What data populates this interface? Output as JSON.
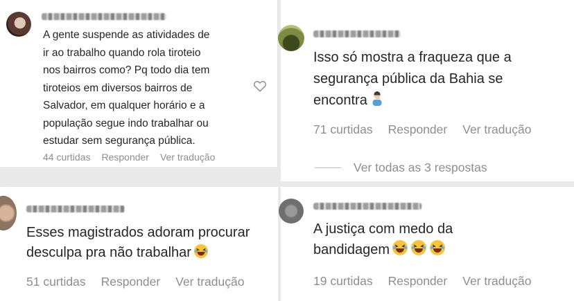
{
  "comments": [
    {
      "text": "A gente suspende as atividades de\nir ao trabalho quando rola tiroteio\nnos bairros como? Pq todo dia tem\ntiroteios em diversos bairros de\nSalvador, em qualquer horário e a\npopulação segue indo trabalhar ou\nestudar sem segurança pública.",
      "likes": "44 curtidas",
      "reply": "Responder",
      "translate": "Ver tradução"
    },
    {
      "text": "Isso só mostra a fraqueza que a\nsegurança pública da Bahia se\nencontra",
      "emoji": "man-facepalming",
      "likes": "71 curtidas",
      "reply": "Responder",
      "translate": "Ver tradução",
      "view_replies": "Ver todas as 3 respostas"
    },
    {
      "text": "Esses magistrados adoram procurar\ndesculpa pra não trabalhar",
      "emoji": "laughing-face",
      "likes": "51 curtidas",
      "reply": "Responder",
      "translate": "Ver tradução"
    },
    {
      "text": "A justiça com medo da\nbandidagem",
      "emoji": "laughing-face x3",
      "likes": "19 curtidas",
      "reply": "Responder",
      "translate": "Ver tradução"
    }
  ],
  "colors": {
    "text": "#262626",
    "muted": "#8e8e8e",
    "background": "#ffffff"
  }
}
